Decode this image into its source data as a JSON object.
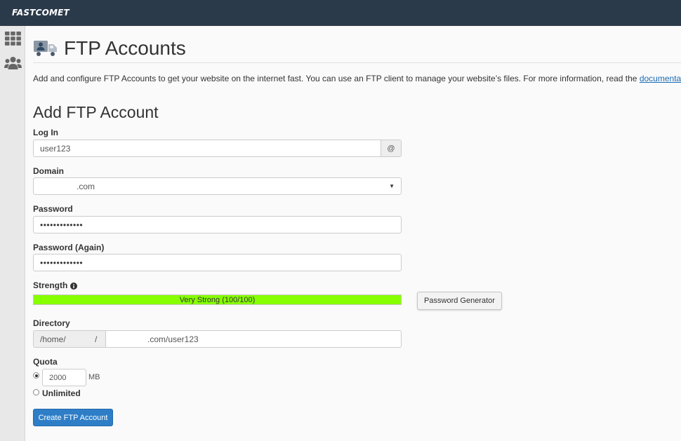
{
  "app": {
    "logo": "FASTCOMET"
  },
  "sidebar": {
    "items": [
      {
        "icon": "grid-icon"
      },
      {
        "icon": "users-icon"
      }
    ]
  },
  "page": {
    "title": "FTP Accounts",
    "description_text": "Add and configure FTP Accounts to get your website on the internet fast. You can use an FTP client to manage your website’s files. For more information, read the ",
    "description_link": "documentation",
    "description_end": "."
  },
  "form": {
    "section_title": "Add FTP Account",
    "login": {
      "label": "Log In",
      "value": "user123",
      "addon": "@"
    },
    "domain": {
      "label": "Domain",
      "value": ".com"
    },
    "password": {
      "label": "Password",
      "value": "•••••••••••••"
    },
    "password_again": {
      "label": "Password (Again)",
      "value": "•••••••••••••"
    },
    "strength": {
      "label": "Strength",
      "text": "Very Strong (100/100)",
      "score": 100,
      "bar_color": "#86ff00"
    },
    "password_generator_label": "Password Generator",
    "directory": {
      "label": "Directory",
      "prefix": "/home/",
      "separator": "/",
      "value": ".com/user123"
    },
    "quota": {
      "label": "Quota",
      "value": "2000",
      "unit": "MB",
      "unlimited_label": "Unlimited",
      "selected": "limited"
    },
    "submit_label": "Create FTP Account"
  },
  "colors": {
    "topbar": "#2b3a4a",
    "accent": "#2e7ec7",
    "link": "#1a6ab5"
  }
}
